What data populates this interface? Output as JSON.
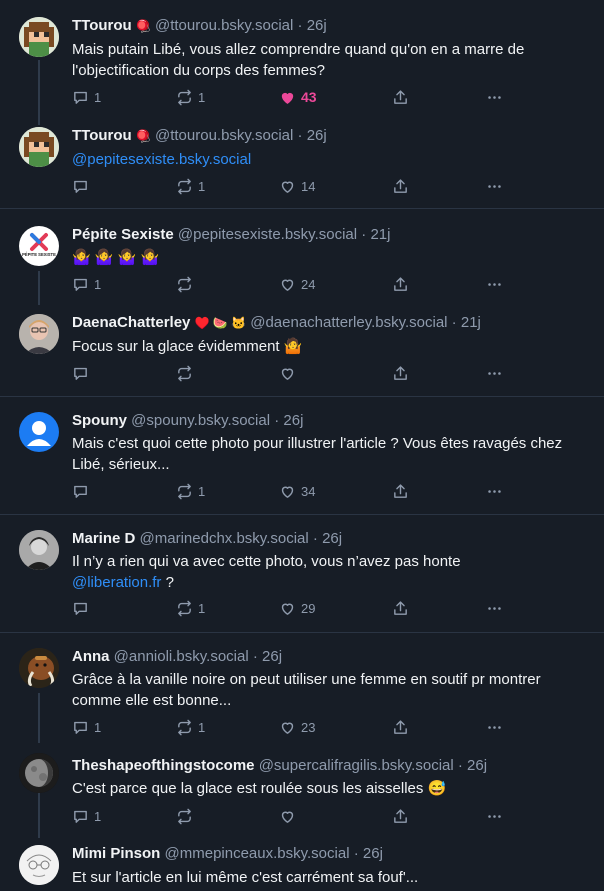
{
  "posts": [
    {
      "name": "TTourou",
      "name_emoji": "🪀",
      "handle": "@ttourou.bsky.social",
      "time": "26j",
      "text": "Mais putain Libé, vous allez comprendre quand qu'on en a marre de l'objectification du corps des femmes?",
      "replies": "1",
      "reposts": "1",
      "likes": "43",
      "liked": true,
      "avatar": "pixel-art-girl"
    },
    {
      "name": "TTourou",
      "name_emoji": "🪀",
      "handle": "@ttourou.bsky.social",
      "time": "26j",
      "mention": "@pepitesexiste.bsky.social",
      "replies": "",
      "reposts": "1",
      "likes": "14",
      "avatar": "pixel-art-girl"
    },
    {
      "name": "Pépite Sexiste",
      "handle": "@pepitesexiste.bsky.social",
      "time": "21j",
      "text": "🤷‍♀️ 🤷‍♀️ 🤷‍♀️ 🤷‍♀️",
      "replies": "1",
      "reposts": "",
      "likes": "24",
      "avatar": "pepite-sexiste-logo",
      "avatar_text": "PÉPITE SEXISTE"
    },
    {
      "name": "DaenaChatterley",
      "name_emoji": "♥️ 🍉 🐱",
      "handle": "@daenachatterley.bsky.social",
      "time": "21j",
      "text": "Focus sur la glace évidemment 🤷",
      "replies": "",
      "reposts": "",
      "likes": "",
      "avatar": "photo"
    },
    {
      "name": "Spouny",
      "handle": "@spouny.bsky.social",
      "time": "26j",
      "text": "Mais c'est quoi cette photo pour illustrer l'article ? Vous êtes ravagés chez Libé, sérieux...",
      "replies": "",
      "reposts": "1",
      "likes": "34",
      "avatar": "default-user"
    },
    {
      "name": "Marine D",
      "handle": "@marinedchx.bsky.social",
      "time": "26j",
      "text": "Il n’y a rien qui va avec cette photo, vous n’avez pas honte",
      "mention": "@liberation.fr",
      "text_after": " ?",
      "replies": "",
      "reposts": "1",
      "likes": "29",
      "avatar": "photo-bw"
    },
    {
      "name": "Anna",
      "handle": "@annioli.bsky.social",
      "time": "26j",
      "text": "Grâce à la vanille noire on peut utiliser une femme en soutif pr montrer comme elle est bonne...",
      "replies": "1",
      "reposts": "1",
      "likes": "23",
      "avatar": "cartoon-mammoth"
    },
    {
      "name": "Theshapeofthingstocome",
      "handle": "@supercalifragilis.bsky.social",
      "time": "26j",
      "text": "C'est parce que la glace est roulée sous les aisselles 😅",
      "replies": "1",
      "reposts": "",
      "likes": "",
      "avatar": "moon"
    },
    {
      "name": "Mimi Pinson",
      "handle": "@mmepinceaux.bsky.social",
      "time": "26j",
      "text": "Et sur l'article en lui même c'est carrément sa fouf'...",
      "avatar": "sketch"
    }
  ],
  "separator": " · ",
  "colors": {
    "background": "#171d26",
    "text": "#f1f3f5",
    "muted": "#8f9bad",
    "link": "#2f8ef7",
    "like_active": "#ec4899"
  },
  "icons": [
    "reply-icon",
    "repost-icon",
    "like-icon",
    "share-icon",
    "more-icon"
  ]
}
